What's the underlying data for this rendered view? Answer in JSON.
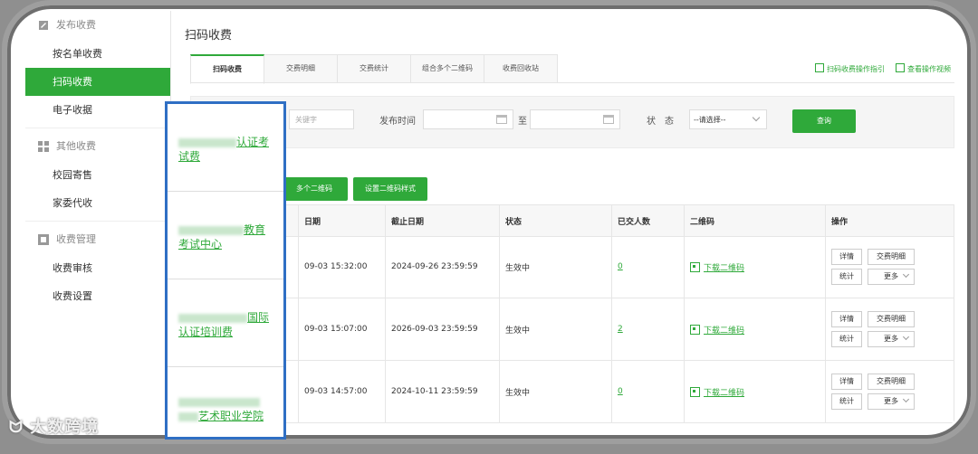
{
  "sidebar": {
    "groups": [
      {
        "label": "发布收费",
        "icon": "edit-icon",
        "items": [
          "按名单收费",
          "扫码收费",
          "电子收据"
        ]
      },
      {
        "label": "其他收费",
        "icon": "grid-icon",
        "items": [
          "校园寄售",
          "家委代收"
        ]
      },
      {
        "label": "收费管理",
        "icon": "manage-icon",
        "items": [
          "收费审核",
          "收费设置"
        ]
      }
    ],
    "active_item": "扫码收费"
  },
  "header": {
    "title": "扫码收费"
  },
  "tabs": [
    "扫码收费",
    "交费明细",
    "交费统计",
    "组合多个二维码",
    "收费回收站"
  ],
  "active_tab": "扫码收费",
  "guides": {
    "guide": "扫码收费操作指引",
    "video": "查看操作视频"
  },
  "filter": {
    "keyword_placeholder": "关键字",
    "publish_label": "发布时间",
    "to_label": "至",
    "status_label": "状　态",
    "status_value": "--请选择--",
    "search_button": "查询"
  },
  "actions": {
    "combine": "多个二维码",
    "style": "设置二维码样式"
  },
  "table": {
    "columns": [
      "",
      "日期",
      "截止日期",
      "状态",
      "已交人数",
      "二维码",
      "操作"
    ],
    "rows": [
      {
        "publish": "09-03 15:32:00",
        "deadline": "2024-09-26 23:59:59",
        "status": "生效中",
        "count": "0",
        "qr": "下载二维码"
      },
      {
        "publish": "09-03 15:07:00",
        "deadline": "2026-09-03 23:59:59",
        "status": "生效中",
        "count": "2",
        "qr": "下载二维码"
      },
      {
        "publish": "09-03 14:57:00",
        "deadline": "2024-10-11 23:59:59",
        "status": "生效中",
        "count": "0",
        "qr": "下载二维码"
      }
    ],
    "ops": {
      "detail": "详情",
      "pay_detail": "交费明细",
      "stats": "统计",
      "more": "更多"
    }
  },
  "highlight": {
    "items": [
      {
        "tail": "认证考",
        "line2": "试费"
      },
      {
        "tail": "教育",
        "line2": "考试中心"
      },
      {
        "tail": "国际",
        "line2": "认证培训费"
      },
      {
        "tail": "艺术职业学院",
        "line2": ""
      }
    ]
  },
  "watermark": "大数跨境",
  "colors": {
    "brand_green": "#2fa93a",
    "highlight_blue": "#2f6fc4"
  }
}
